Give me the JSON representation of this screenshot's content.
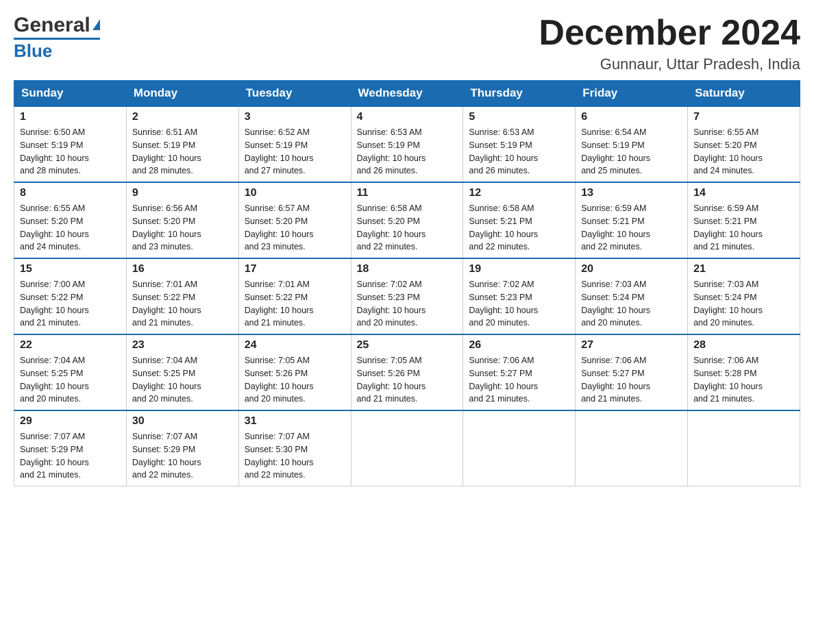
{
  "logo": {
    "general": "General",
    "blue": "Blue"
  },
  "header": {
    "month": "December 2024",
    "location": "Gunnaur, Uttar Pradesh, India"
  },
  "weekdays": [
    "Sunday",
    "Monday",
    "Tuesday",
    "Wednesday",
    "Thursday",
    "Friday",
    "Saturday"
  ],
  "weeks": [
    [
      {
        "day": "1",
        "sunrise": "6:50 AM",
        "sunset": "5:19 PM",
        "daylight": "10 hours and 28 minutes."
      },
      {
        "day": "2",
        "sunrise": "6:51 AM",
        "sunset": "5:19 PM",
        "daylight": "10 hours and 28 minutes."
      },
      {
        "day": "3",
        "sunrise": "6:52 AM",
        "sunset": "5:19 PM",
        "daylight": "10 hours and 27 minutes."
      },
      {
        "day": "4",
        "sunrise": "6:53 AM",
        "sunset": "5:19 PM",
        "daylight": "10 hours and 26 minutes."
      },
      {
        "day": "5",
        "sunrise": "6:53 AM",
        "sunset": "5:19 PM",
        "daylight": "10 hours and 26 minutes."
      },
      {
        "day": "6",
        "sunrise": "6:54 AM",
        "sunset": "5:19 PM",
        "daylight": "10 hours and 25 minutes."
      },
      {
        "day": "7",
        "sunrise": "6:55 AM",
        "sunset": "5:20 PM",
        "daylight": "10 hours and 24 minutes."
      }
    ],
    [
      {
        "day": "8",
        "sunrise": "6:55 AM",
        "sunset": "5:20 PM",
        "daylight": "10 hours and 24 minutes."
      },
      {
        "day": "9",
        "sunrise": "6:56 AM",
        "sunset": "5:20 PM",
        "daylight": "10 hours and 23 minutes."
      },
      {
        "day": "10",
        "sunrise": "6:57 AM",
        "sunset": "5:20 PM",
        "daylight": "10 hours and 23 minutes."
      },
      {
        "day": "11",
        "sunrise": "6:58 AM",
        "sunset": "5:20 PM",
        "daylight": "10 hours and 22 minutes."
      },
      {
        "day": "12",
        "sunrise": "6:58 AM",
        "sunset": "5:21 PM",
        "daylight": "10 hours and 22 minutes."
      },
      {
        "day": "13",
        "sunrise": "6:59 AM",
        "sunset": "5:21 PM",
        "daylight": "10 hours and 22 minutes."
      },
      {
        "day": "14",
        "sunrise": "6:59 AM",
        "sunset": "5:21 PM",
        "daylight": "10 hours and 21 minutes."
      }
    ],
    [
      {
        "day": "15",
        "sunrise": "7:00 AM",
        "sunset": "5:22 PM",
        "daylight": "10 hours and 21 minutes."
      },
      {
        "day": "16",
        "sunrise": "7:01 AM",
        "sunset": "5:22 PM",
        "daylight": "10 hours and 21 minutes."
      },
      {
        "day": "17",
        "sunrise": "7:01 AM",
        "sunset": "5:22 PM",
        "daylight": "10 hours and 21 minutes."
      },
      {
        "day": "18",
        "sunrise": "7:02 AM",
        "sunset": "5:23 PM",
        "daylight": "10 hours and 20 minutes."
      },
      {
        "day": "19",
        "sunrise": "7:02 AM",
        "sunset": "5:23 PM",
        "daylight": "10 hours and 20 minutes."
      },
      {
        "day": "20",
        "sunrise": "7:03 AM",
        "sunset": "5:24 PM",
        "daylight": "10 hours and 20 minutes."
      },
      {
        "day": "21",
        "sunrise": "7:03 AM",
        "sunset": "5:24 PM",
        "daylight": "10 hours and 20 minutes."
      }
    ],
    [
      {
        "day": "22",
        "sunrise": "7:04 AM",
        "sunset": "5:25 PM",
        "daylight": "10 hours and 20 minutes."
      },
      {
        "day": "23",
        "sunrise": "7:04 AM",
        "sunset": "5:25 PM",
        "daylight": "10 hours and 20 minutes."
      },
      {
        "day": "24",
        "sunrise": "7:05 AM",
        "sunset": "5:26 PM",
        "daylight": "10 hours and 20 minutes."
      },
      {
        "day": "25",
        "sunrise": "7:05 AM",
        "sunset": "5:26 PM",
        "daylight": "10 hours and 21 minutes."
      },
      {
        "day": "26",
        "sunrise": "7:06 AM",
        "sunset": "5:27 PM",
        "daylight": "10 hours and 21 minutes."
      },
      {
        "day": "27",
        "sunrise": "7:06 AM",
        "sunset": "5:27 PM",
        "daylight": "10 hours and 21 minutes."
      },
      {
        "day": "28",
        "sunrise": "7:06 AM",
        "sunset": "5:28 PM",
        "daylight": "10 hours and 21 minutes."
      }
    ],
    [
      {
        "day": "29",
        "sunrise": "7:07 AM",
        "sunset": "5:29 PM",
        "daylight": "10 hours and 21 minutes."
      },
      {
        "day": "30",
        "sunrise": "7:07 AM",
        "sunset": "5:29 PM",
        "daylight": "10 hours and 22 minutes."
      },
      {
        "day": "31",
        "sunrise": "7:07 AM",
        "sunset": "5:30 PM",
        "daylight": "10 hours and 22 minutes."
      },
      null,
      null,
      null,
      null
    ]
  ],
  "labels": {
    "sunrise": "Sunrise:",
    "sunset": "Sunset:",
    "daylight": "Daylight:"
  }
}
